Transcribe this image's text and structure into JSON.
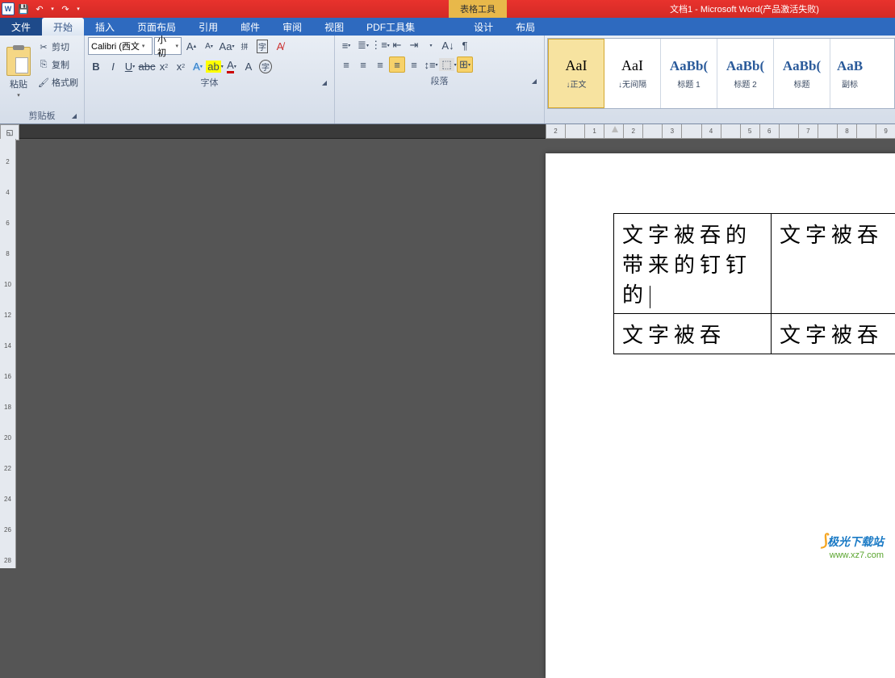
{
  "titlebar": {
    "contextual_tab": "表格工具",
    "title": "文档1 - Microsoft Word(产品激活失败)"
  },
  "tabs": {
    "file": "文件",
    "home": "开始",
    "insert": "插入",
    "layout": "页面布局",
    "references": "引用",
    "mail": "邮件",
    "review": "审阅",
    "view": "视图",
    "pdf": "PDF工具集",
    "design": "设计",
    "table_layout": "布局"
  },
  "clipboard": {
    "paste": "粘贴",
    "cut": "剪切",
    "copy": "复制",
    "format_painter": "格式刷",
    "group_label": "剪贴板"
  },
  "font": {
    "name": "Calibri (西文",
    "size": "小初",
    "group_label": "字体"
  },
  "paragraph": {
    "group_label": "段落"
  },
  "styles": {
    "items": [
      {
        "preview": "AaI",
        "name": "↓正文",
        "cls": ""
      },
      {
        "preview": "AaI",
        "name": "↓无间隔",
        "cls": ""
      },
      {
        "preview": "AaBb(",
        "name": "标题 1",
        "cls": "heading"
      },
      {
        "preview": "AaBb(",
        "name": "标题 2",
        "cls": "heading"
      },
      {
        "preview": "AaBb(",
        "name": "标题",
        "cls": "heading"
      },
      {
        "preview": "AaB",
        "name": "副标",
        "cls": "heading"
      }
    ]
  },
  "ruler_h": [
    "2",
    "",
    "1",
    "",
    "2",
    "",
    "3",
    "",
    "4",
    "",
    "5",
    "6",
    "",
    "7",
    "",
    "8",
    "",
    "9",
    ""
  ],
  "ruler_v": [
    "",
    "2",
    "",
    "4",
    "",
    "6",
    "",
    "8",
    "",
    "10",
    "",
    "12",
    "",
    "14",
    "",
    "16",
    "",
    "18",
    "",
    "20",
    "",
    "22",
    "",
    "24",
    "",
    "26",
    "",
    "28",
    ""
  ],
  "table": {
    "r1c1": "文字被吞的带来的钉钉的",
    "r1c2": "文字被吞",
    "r2c1": "文字被吞",
    "r2c2": "文字被吞"
  },
  "watermark": {
    "name": "极光下载站",
    "url": "www.xz7.com"
  }
}
